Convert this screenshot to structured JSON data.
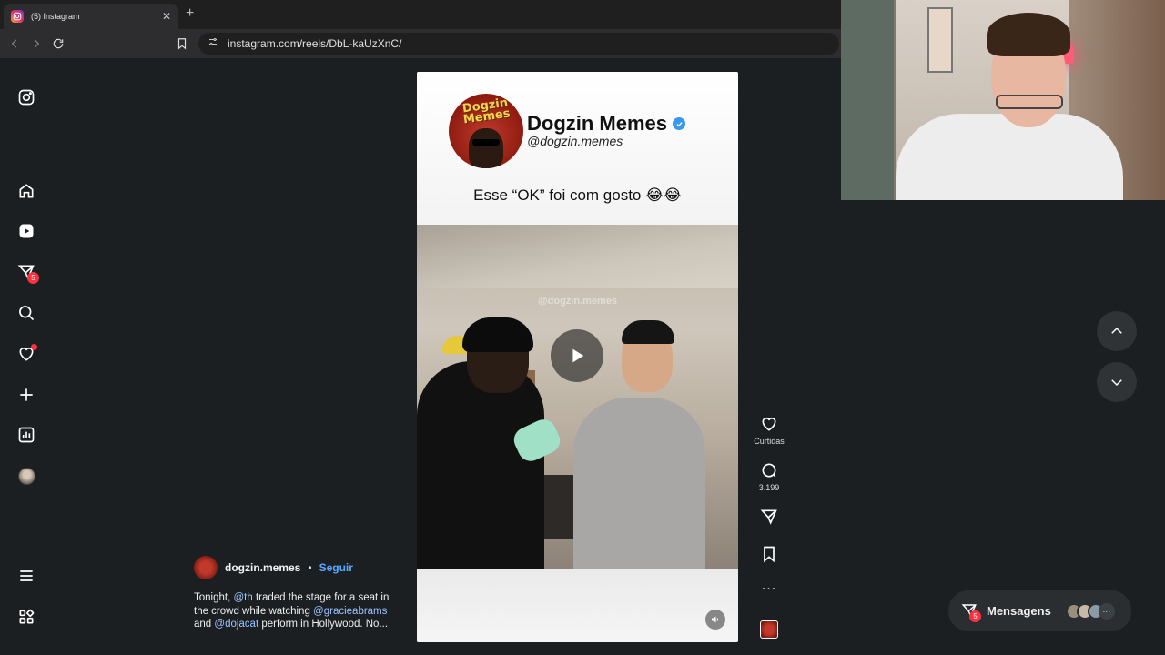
{
  "browser": {
    "tab_title": "(5) Instagram",
    "tab_close": "✕",
    "new_tab": "+",
    "url": "instagram.com/reels/DbL-kaUzXnC/"
  },
  "sidebar": {
    "messages_badge": "5",
    "icons": [
      "instagram-icon",
      "home-icon",
      "reels-icon",
      "messages-icon",
      "search-icon",
      "heart-icon",
      "plus-icon",
      "dashboard-icon",
      "avatar",
      "menu-icon",
      "apps-icon"
    ]
  },
  "reel": {
    "brand_logo_text": "Dogzin Memes",
    "brand_name": "Dogzin Memes",
    "brand_handle": "@dogzin.memes",
    "caption_top": "Esse “OK” foi com gosto 😂😂",
    "watermark": "@dogzin.memes"
  },
  "actions": {
    "like_label": "Curtidas",
    "comment_count": "3.199",
    "more": "..."
  },
  "post": {
    "username": "dogzin.memes",
    "separator": "•",
    "follow": "Seguir",
    "caption_1": "Tonight, ",
    "mention_1": "@th",
    "caption_2": " traded the stage for a seat in the crowd while watching ",
    "mention_2": "@gracieabrams",
    "caption_3": " and ",
    "mention_3": "@dojacat",
    "caption_4": " perform in Hollywood. No..."
  },
  "messages": {
    "label": "Mensagens",
    "badge": "5",
    "more": "···"
  },
  "colors": {
    "accent": "#5aa8ff",
    "badge": "#ff3040",
    "background": "#1b1f22"
  }
}
